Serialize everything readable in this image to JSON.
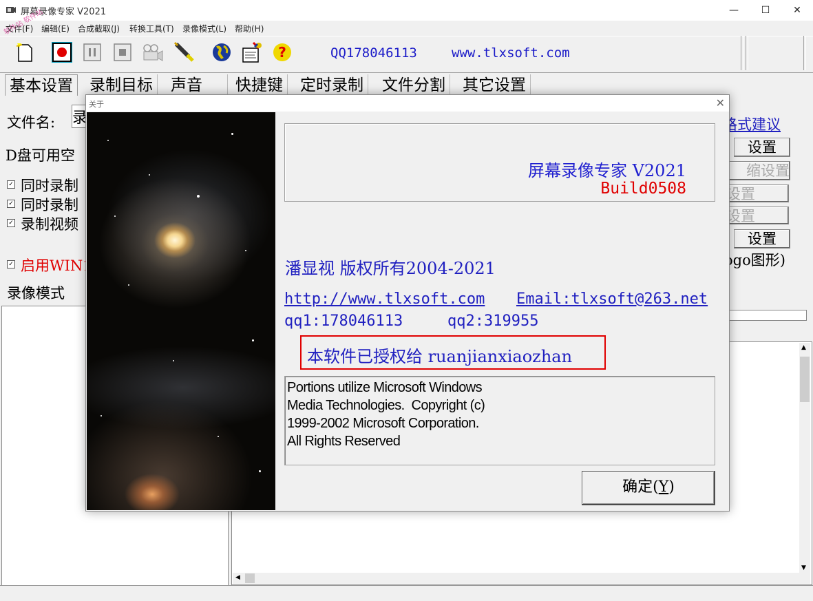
{
  "window": {
    "title": "屏幕录像专家 V2021",
    "min": "—",
    "max": "☐",
    "close": "✕"
  },
  "menu": [
    "文件(F)",
    "编辑(E)",
    "合成截取(J)",
    "转换工具(T)",
    "录像模式(L)",
    "帮助(H)"
  ],
  "watermark": "软件站 软件站",
  "toolbar": {
    "qq": "QQ178046113",
    "site": "www.tlxsoft.com",
    "icons": [
      "new-file-icon",
      "record-icon",
      "pause-icon",
      "stop-icon",
      "camera-icon",
      "pen-icon",
      "globe-icon",
      "settings-icon",
      "help-icon"
    ]
  },
  "tabs": [
    "基本设置",
    "录制目标",
    "声音",
    "快捷键",
    "定时录制",
    "文件分割",
    "其它设置"
  ],
  "background": {
    "filename_label": "文件名:",
    "filename_value": "录",
    "disk_label": "D盘可用空",
    "check1": "同时录制",
    "check2": "同时录制",
    "check3": "录制视频",
    "check4": "启用WIN1",
    "mode_label": "录像模式",
    "format_link": "格式建议",
    "btn_set1": "设置",
    "btn_compress": "缩设置",
    "btn_set2": "设置",
    "btn_set3": "设置",
    "btn_set4": "设置",
    "logo_text": "ogo图形)"
  },
  "dialog": {
    "title": "关于",
    "close": "✕",
    "product": "屏幕录像专家 V2021",
    "build": "Build0508",
    "copyright": "潘显视 版权所有2004-2021",
    "url": "http://www.tlxsoft.com",
    "email": "Email:tlxsoft@263.net",
    "qq1": "qq1:178046113",
    "qq2": "qq2:319955",
    "license": "本软件已授权给 ruanjianxiaozhan",
    "ms_notice": "Portions utilize Microsoft Windows\nMedia Technologies.  Copyright (c)\n1999-2002 Microsoft Corporation.\nAll Rights Reserved",
    "ok_button": "确定(Y)"
  },
  "colors": {
    "accent_blue": "#2020c0",
    "red": "#e00000"
  }
}
